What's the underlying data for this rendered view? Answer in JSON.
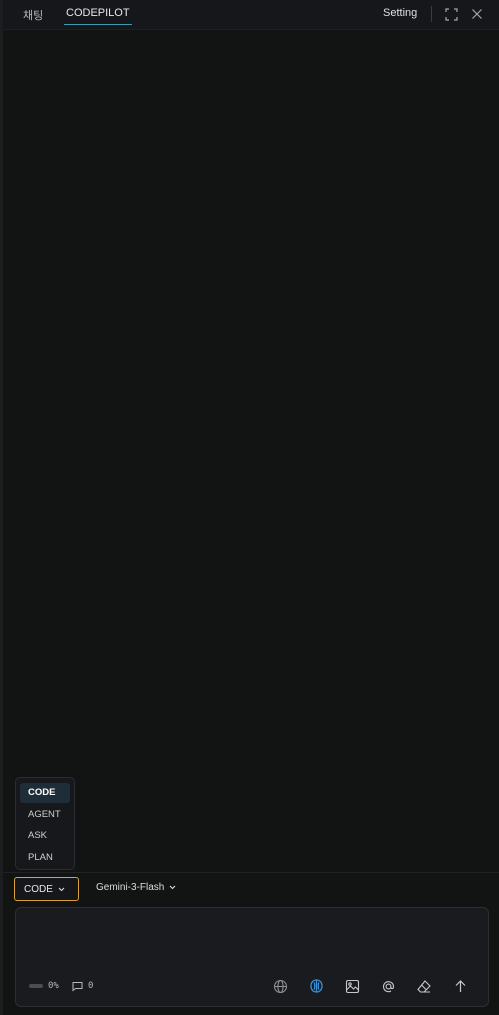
{
  "header": {
    "tabs": [
      {
        "label": "채팅",
        "active": false
      },
      {
        "label": "CODEPILOT",
        "active": true
      }
    ],
    "setting_label": "Setting",
    "icons": [
      "expand-icon",
      "close-icon"
    ]
  },
  "mode_menu": {
    "items": [
      {
        "label": "CODE",
        "active": true
      },
      {
        "label": "AGENT",
        "active": false
      },
      {
        "label": "ASK",
        "active": false
      },
      {
        "label": "PLAN",
        "active": false
      }
    ]
  },
  "controls": {
    "mode_selected": "CODE",
    "model_selected": "Gemini-3-Flash"
  },
  "input": {
    "value": "",
    "placeholder": "",
    "progress_label": "0%",
    "progress_fraction": 0.0,
    "message_count": "0",
    "tools": [
      "globe-icon",
      "brain-icon",
      "image-icon",
      "at-icon",
      "eraser-icon",
      "send-arrow-icon"
    ]
  },
  "colors": {
    "background": "#121414",
    "accent_tab": "#3c9db0",
    "focus_border": "#d8a13a",
    "brain_icon": "#3a8fd6"
  }
}
